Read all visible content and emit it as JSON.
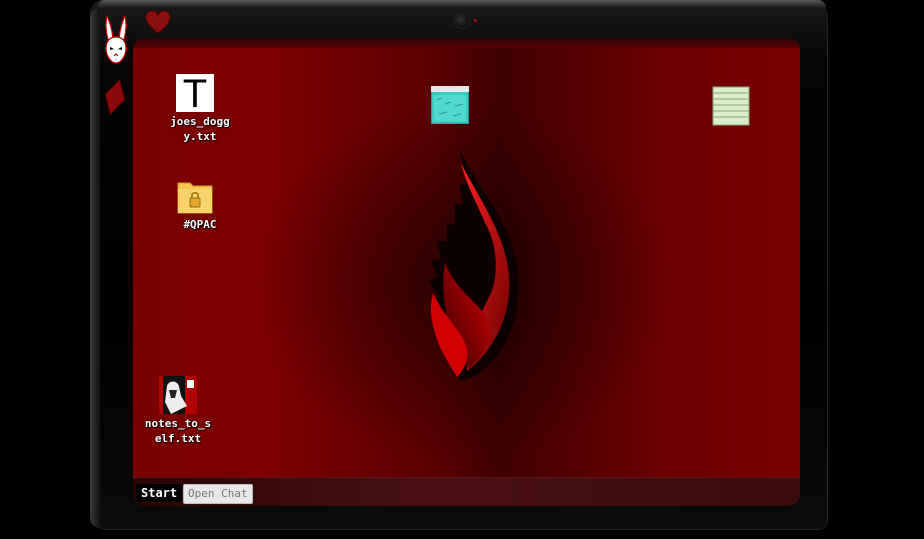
{
  "device": {
    "top_icons": [
      "heart-icon",
      "camera-icon"
    ],
    "side_icons": [
      "rabbit-icon",
      "diamond-card-icon"
    ]
  },
  "desktop": {
    "wallpaper": "flame-logo",
    "icons": [
      {
        "name": "joes_doggy-file-icon",
        "label": "joes_dogg\ny.txt",
        "glyph": "T"
      },
      {
        "name": "qpac-folder-icon",
        "label": "#QPAC",
        "glyph": "folder-lock-icon"
      },
      {
        "name": "notes-to-self-file-icon",
        "label": "notes_to_s\nelf.txt",
        "glyph": "photo-thumbnail-icon"
      },
      {
        "name": "cyan-image-file-icon",
        "label": "",
        "glyph": "cyan-image-thumbnail"
      },
      {
        "name": "green-notes-file-icon",
        "label": "",
        "glyph": "stacked-notes-icon"
      }
    ]
  },
  "taskbar": {
    "start_label": "Start",
    "chat_label": "Open Chat"
  },
  "colors": {
    "screen_red": "#7a0000",
    "accent_red": "#c00000",
    "frame_black": "#000000"
  }
}
